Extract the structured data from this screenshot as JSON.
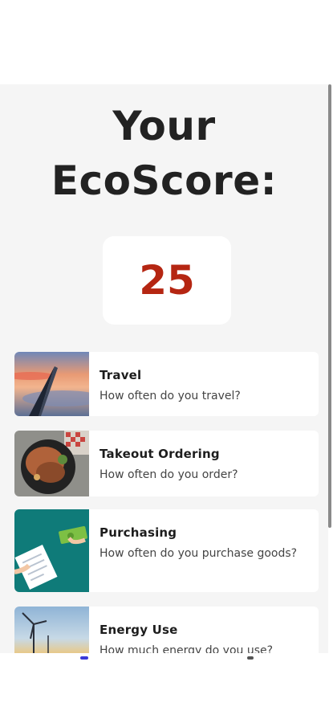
{
  "page": {
    "title": "Your\nEcoScore:",
    "score": "25"
  },
  "categories": [
    {
      "title": "Travel",
      "subtitle": "How often do you travel?",
      "icon": "airplane-wing-image"
    },
    {
      "title": "Takeout Ordering",
      "subtitle": "How often do you order?",
      "icon": "takeout-food-image"
    },
    {
      "title": "Purchasing",
      "subtitle": "How often do you purchase goods?",
      "icon": "purchasing-illustration"
    },
    {
      "title": "Energy Use",
      "subtitle": "How much energy do you use?",
      "icon": "wind-turbine-image"
    }
  ],
  "colors": {
    "score": "#b52612",
    "background": "#f5f5f5",
    "purchasing_tile": "#0f7b79"
  }
}
